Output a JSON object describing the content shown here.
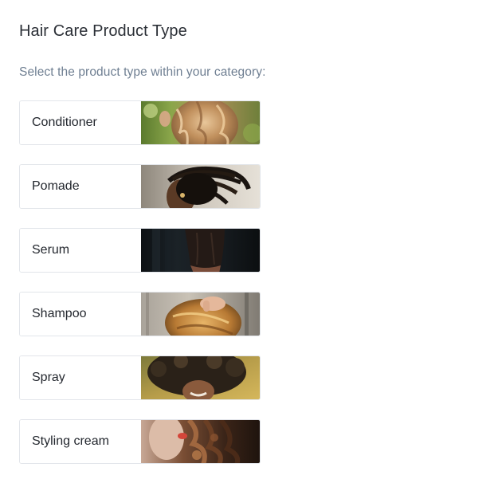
{
  "page": {
    "title": "Hair Care Product Type",
    "subtitle": "Select the product type within your category:"
  },
  "options": [
    {
      "label": "Conditioner",
      "image": "wavy-blonde-hair-photo"
    },
    {
      "label": "Pomade",
      "image": "dreadlocks-profile-photo"
    },
    {
      "label": "Serum",
      "image": "dark-bob-hair-photo"
    },
    {
      "label": "Shampoo",
      "image": "hand-in-golden-hair-photo"
    },
    {
      "label": "Spray",
      "image": "curly-afro-smile-photo"
    },
    {
      "label": "Styling cream",
      "image": "curly-brown-hair-photo"
    }
  ]
}
